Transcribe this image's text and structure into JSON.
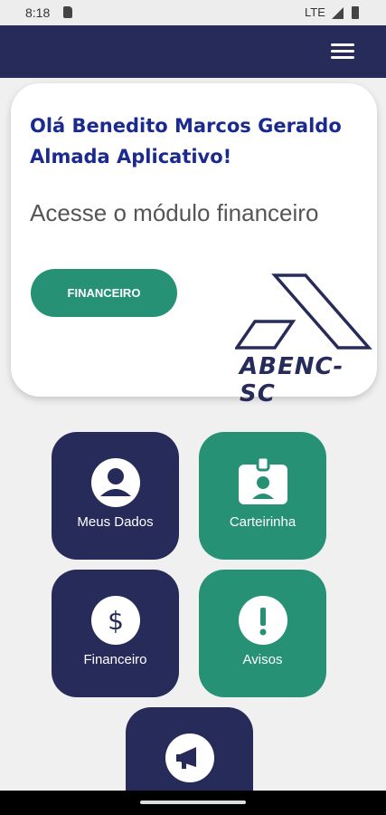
{
  "status_bar": {
    "time": "8:18",
    "network": "LTE"
  },
  "app_bar": {
    "menu_icon": "hamburger-menu-icon"
  },
  "welcome_card": {
    "greeting": "Olá Benedito Marcos Geraldo Almada Aplicativo!",
    "subtitle": "Acesse o módulo financeiro",
    "button_label": "FINANCEIRO",
    "logo_text": "ABENC-SC"
  },
  "tiles": [
    {
      "label": "Meus Dados",
      "icon": "user-icon",
      "color": "#272b59"
    },
    {
      "label": "Carteirinha",
      "icon": "id-badge-icon",
      "color": "#279176"
    },
    {
      "label": "Financeiro",
      "icon": "dollar-icon",
      "color": "#272b59"
    },
    {
      "label": "Avisos",
      "icon": "exclamation-icon",
      "color": "#279176"
    },
    {
      "label": "",
      "icon": "megaphone-icon",
      "color": "#272b59"
    }
  ],
  "colors": {
    "navy": "#272b59",
    "green": "#279176",
    "title_blue": "#1b2a8f"
  }
}
